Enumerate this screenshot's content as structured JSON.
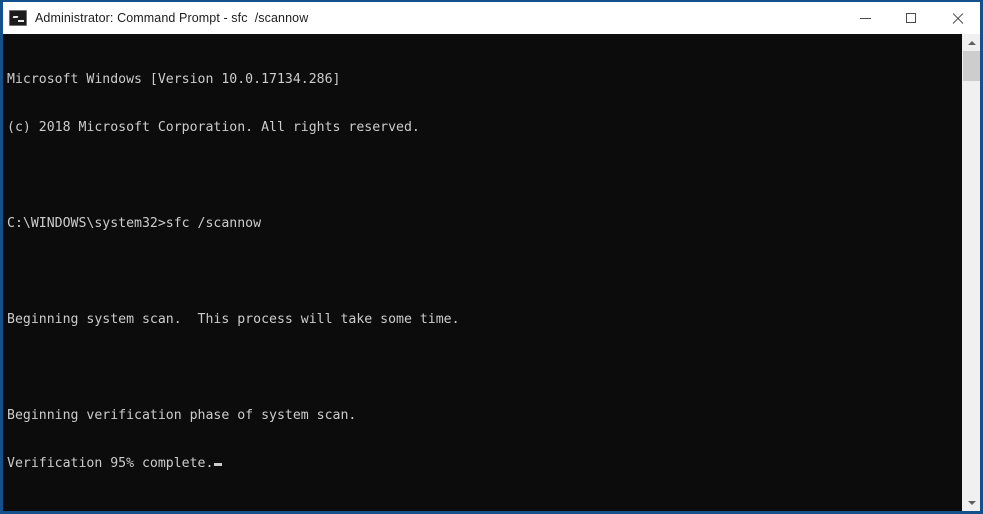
{
  "window": {
    "title": "Administrator: Command Prompt - sfc  /scannow",
    "icon": "cmd-console-icon",
    "border_color": "#14518c",
    "titlebar_bg": "#ffffff",
    "console_bg": "#0c0c0c",
    "console_fg": "#cccccc"
  },
  "window_controls": {
    "minimize_label": "─",
    "maximize_label": "□",
    "close_label": "✕",
    "minimize_name": "minimize",
    "maximize_name": "maximize",
    "close_name": "close"
  },
  "console": {
    "lines": [
      "Microsoft Windows [Version 10.0.17134.286]",
      "(c) 2018 Microsoft Corporation. All rights reserved.",
      "",
      "C:\\WINDOWS\\system32>sfc /scannow",
      "",
      "Beginning system scan.  This process will take some time.",
      "",
      "Beginning verification phase of system scan.",
      "Verification 95% complete."
    ],
    "prompt_path": "C:\\WINDOWS\\system32>",
    "command": "sfc /scannow",
    "progress_percent": "95%",
    "cursor_visible": "true"
  },
  "scrollbar": {
    "up_arrow": "▲",
    "down_arrow": "▼",
    "thumb_top_px": "0",
    "thumb_height_px": "30",
    "track_color": "#f0f0f0",
    "thumb_color": "#cdcdcd"
  }
}
